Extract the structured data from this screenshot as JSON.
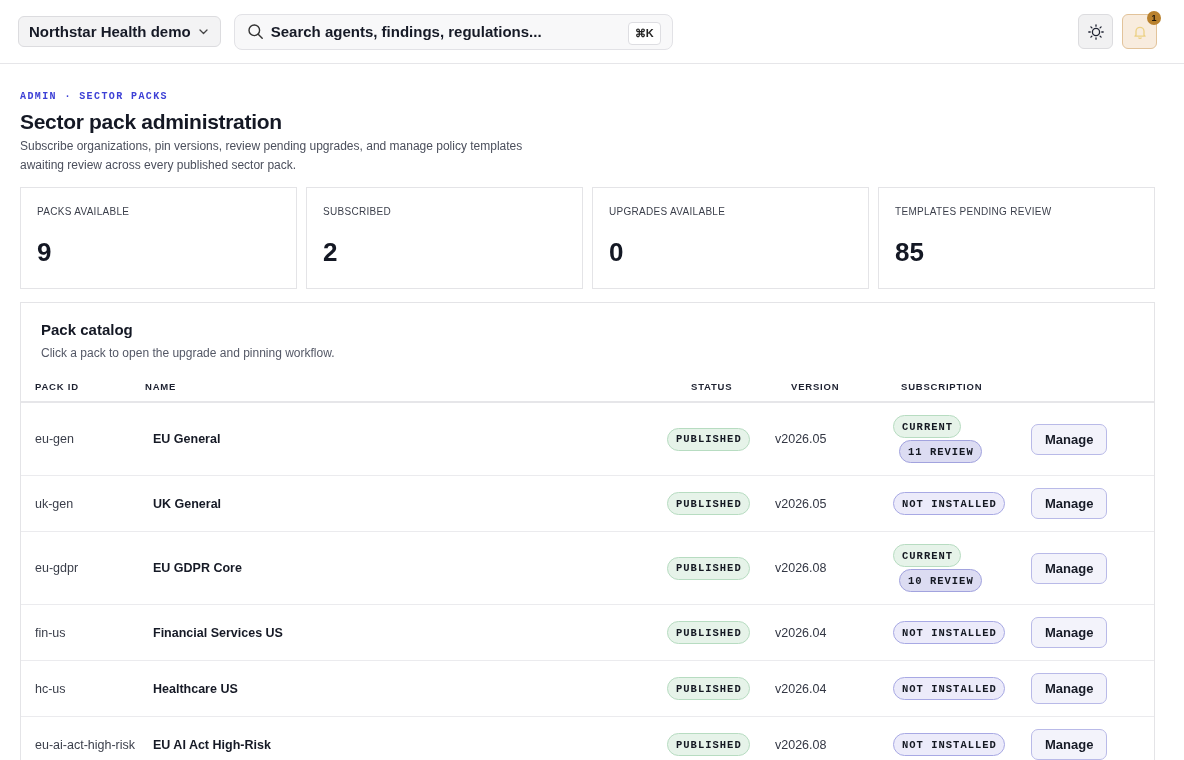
{
  "header": {
    "org_selector": {
      "label": "Northstar Health demo"
    },
    "search": {
      "placeholder": "Search agents, findings, regulations...",
      "shortcut": "⌘K"
    },
    "notifications": {
      "count": "1"
    }
  },
  "page": {
    "breadcrumb": "ADMIN · SECTOR PACKS",
    "title": "Sector pack administration",
    "description": "Subscribe organizations, pin versions, review pending upgrades, and manage policy templates awaiting review across every published sector pack."
  },
  "stats": [
    {
      "label": "PACKS AVAILABLE",
      "value": "9"
    },
    {
      "label": "SUBSCRIBED",
      "value": "2"
    },
    {
      "label": "UPGRADES AVAILABLE",
      "value": "0"
    },
    {
      "label": "TEMPLATES PENDING REVIEW",
      "value": "85"
    }
  ],
  "catalog": {
    "title": "Pack catalog",
    "subtitle": "Click a pack to open the upgrade and pinning workflow.",
    "columns": [
      "PACK ID",
      "NAME",
      "STATUS",
      "VERSION",
      "SUBSCRIPTION"
    ],
    "rows": [
      {
        "pack_id": "eu-gen",
        "name": "EU General",
        "status": {
          "label": "PUBLISHED",
          "kind": "published"
        },
        "version": "v2026.05",
        "subscription": [
          {
            "label": "CURRENT",
            "kind": "current"
          },
          {
            "label": "11 REVIEW",
            "kind": "review"
          }
        ],
        "action": "Manage"
      },
      {
        "pack_id": "uk-gen",
        "name": "UK General",
        "status": {
          "label": "PUBLISHED",
          "kind": "published"
        },
        "version": "v2026.05",
        "subscription": [
          {
            "label": "NOT INSTALLED",
            "kind": "not_installed"
          }
        ],
        "action": "Manage"
      },
      {
        "pack_id": "eu-gdpr",
        "name": "EU GDPR Core",
        "status": {
          "label": "PUBLISHED",
          "kind": "published"
        },
        "version": "v2026.08",
        "subscription": [
          {
            "label": "CURRENT",
            "kind": "current"
          },
          {
            "label": "10 REVIEW",
            "kind": "review"
          }
        ],
        "action": "Manage"
      },
      {
        "pack_id": "fin-us",
        "name": "Financial Services US",
        "status": {
          "label": "PUBLISHED",
          "kind": "published"
        },
        "version": "v2026.04",
        "subscription": [
          {
            "label": "NOT INSTALLED",
            "kind": "not_installed"
          }
        ],
        "action": "Manage"
      },
      {
        "pack_id": "hc-us",
        "name": "Healthcare US",
        "status": {
          "label": "PUBLISHED",
          "kind": "published"
        },
        "version": "v2026.04",
        "subscription": [
          {
            "label": "NOT INSTALLED",
            "kind": "not_installed"
          }
        ],
        "action": "Manage"
      },
      {
        "pack_id": "eu-ai-act-high-risk",
        "name": "EU AI Act High-Risk",
        "status": {
          "label": "PUBLISHED",
          "kind": "published"
        },
        "version": "v2026.08",
        "subscription": [
          {
            "label": "NOT INSTALLED",
            "kind": "not_installed"
          }
        ],
        "action": "Manage"
      }
    ]
  }
}
